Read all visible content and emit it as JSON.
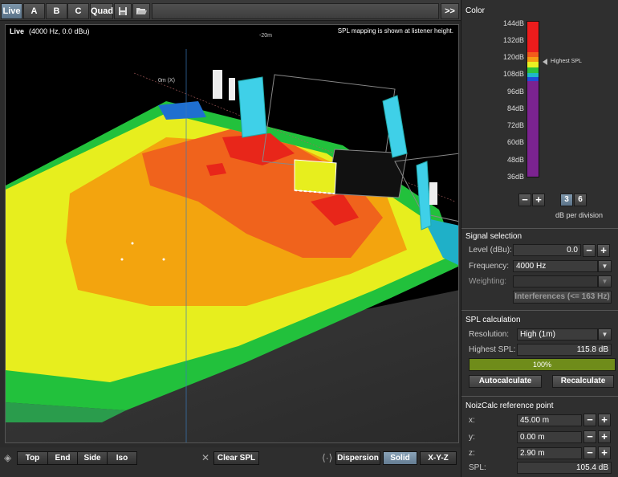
{
  "toolbar": {
    "tabs": [
      {
        "label": "Live",
        "active": true
      },
      {
        "label": "A",
        "active": false
      },
      {
        "label": "B",
        "active": false
      },
      {
        "label": "C",
        "active": false
      },
      {
        "label": "Quad",
        "active": false
      }
    ],
    "save_icon": "floppy-disk-icon",
    "open_icon": "folder-open-icon",
    "expand_label": ">>"
  },
  "viewport": {
    "mode": "Live",
    "condition": "(4000 Hz, 0.0 dBu)",
    "note": "SPL mapping is shown at listener height.",
    "axis_label_top": "-20m",
    "axis_label_x": "0m (X)"
  },
  "bottom": {
    "view_buttons": [
      "Top",
      "End",
      "Side",
      "Iso"
    ],
    "clear_label": "Clear SPL",
    "render_buttons": [
      "Dispersion",
      "Solid",
      "X-Y-Z"
    ],
    "active_render": "Solid"
  },
  "panel": {
    "color": {
      "title": "Color",
      "ticks": [
        "144dB",
        "132dB",
        "120dB",
        "108dB",
        "96dB",
        "84dB",
        "72dB",
        "60dB",
        "48dB",
        "36dB"
      ],
      "highest_marker_label": "Highest SPL",
      "minus": "−",
      "plus": "+",
      "division_options": [
        "3",
        "6"
      ],
      "active_division": "3",
      "division_label": "dB per division"
    },
    "signal": {
      "title": "Signal selection",
      "level_label": "Level (dBu):",
      "level_value": "0.0",
      "frequency_label": "Frequency:",
      "frequency_value": "4000 Hz",
      "weighting_label": "Weighting:",
      "weighting_value": "",
      "interferences_label": "Interferences (<= 163 Hz)"
    },
    "spl": {
      "title": "SPL calculation",
      "resolution_label": "Resolution:",
      "resolution_value": "High (1m)",
      "highest_label": "Highest SPL:",
      "highest_value": "115.8 dB",
      "progress_text": "100%",
      "progress_fraction": 1.0,
      "autocalc_label": "Autocalculate",
      "recalc_label": "Recalculate"
    },
    "reference": {
      "title": "NoizCalc reference point",
      "x_label": "x:",
      "x_value": "45.00 m",
      "y_label": "y:",
      "y_value": "0.00 m",
      "z_label": "z:",
      "z_value": "2.90 m",
      "spl_label": "SPL:",
      "spl_value": "105.4 dB"
    }
  },
  "colors": {
    "accent_blue": "#6b8aa3",
    "progress_green": "#6f8c1a",
    "speaker_cyan": "#3fd0e8"
  }
}
